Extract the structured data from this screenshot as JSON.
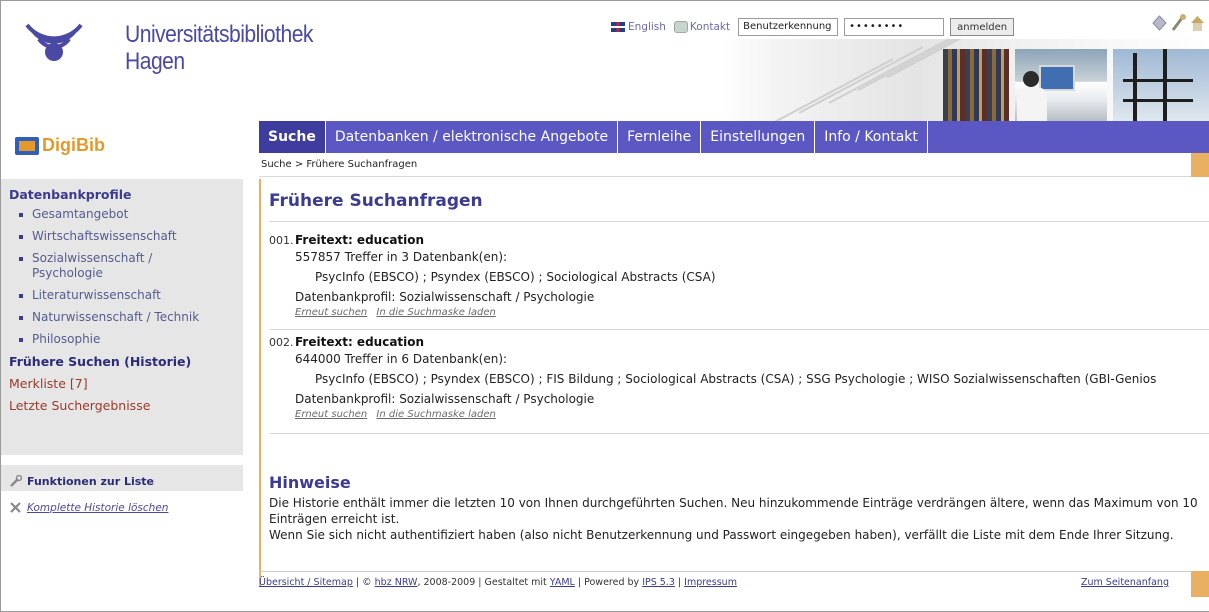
{
  "header": {
    "uni_name_line1": "Universitätsbibliothek",
    "uni_name_line2": "Hagen",
    "english_label": "English",
    "contact_label": "Kontakt",
    "username_value": "Benutzerkennung",
    "password_value": "••••••••",
    "login_label": "anmelden"
  },
  "brand": {
    "digibib": "DigiBib"
  },
  "nav": {
    "tabs": [
      {
        "label": "Suche",
        "active": true
      },
      {
        "label": "Datenbanken / elektronische Angebote",
        "active": false
      },
      {
        "label": "Fernleihe",
        "active": false
      },
      {
        "label": "Einstellungen",
        "active": false
      },
      {
        "label": "Info / Kontakt",
        "active": false
      }
    ],
    "breadcrumb": "Suche > Frühere Suchanfragen"
  },
  "sidebar": {
    "profiles_heading": "Datenbankprofile",
    "items": [
      {
        "label": "Gesamtangebot"
      },
      {
        "label": "Wirtschaftswissenschaft"
      },
      {
        "label": "Sozialwissenschaft / Psychologie"
      },
      {
        "label": "Literaturwissenschaft"
      },
      {
        "label": "Naturwissenschaft / Technik"
      },
      {
        "label": "Philosophie"
      }
    ],
    "history_label": "Frühere Suchen (Historie)",
    "watchlist_label": "Merkliste [7]",
    "last_results_label": "Letzte Suchergebnisse",
    "functions_title": "Funktionen zur Liste",
    "clear_history_label": "Komplette Historie löschen"
  },
  "main": {
    "title": "Frühere Suchanfragen",
    "entries": [
      {
        "number": "001.",
        "query": "Freitext: education",
        "hits": "557857 Treffer in 3 Datenbank(en):",
        "databases": "PsycInfo (EBSCO) ;  Psyndex (EBSCO) ;  Sociological Abstracts (CSA)",
        "profile": "Datenbankprofil: Sozialwissenschaft / Psychologie",
        "action_search_again": "Erneut suchen",
        "action_load_mask": "In die Suchmaske laden"
      },
      {
        "number": "002.",
        "query": "Freitext: education",
        "hits": "644000 Treffer in 6 Datenbank(en):",
        "databases": "PsycInfo (EBSCO) ;  Psyndex (EBSCO) ;  FIS Bildung ;  Sociological Abstracts (CSA) ;  SSG Psychologie ;  WISO Sozialwissenschaften (GBI-Genios",
        "profile": "Datenbankprofil: Sozialwissenschaft / Psychologie",
        "action_search_again": "Erneut suchen",
        "action_load_mask": "In die Suchmaske laden"
      }
    ],
    "hints_title": "Hinweise",
    "hints_line1": "Die Historie enthält immer die letzten 10 von Ihnen durchgeführten Suchen. Neu hinzukommende Einträge verdrängen ältere, wenn das Maximum von 10 Einträgen erreicht ist.",
    "hints_line2": "Wenn Sie sich nicht authentifiziert haben (also nicht Benutzerkennung und Passwort eingegeben haben), verfällt die Liste mit dem Ende Ihrer Sitzung."
  },
  "footer": {
    "sitemap": "Übersicht / Sitemap",
    "sep1": " | © ",
    "hbz": "hbz NRW",
    "years": ", 2008-2009 | Gestaltet mit ",
    "yaml": "YAML",
    "powered": " | Powered by ",
    "ips": "IPS 5.3",
    "sep2": " | ",
    "impressum": "Impressum",
    "to_top": "Zum Seitenanfang"
  },
  "colors": {
    "nav_bg": "#5b58c4",
    "accent_orange": "#e8b060",
    "heading_blue": "#3b3b90",
    "digibib_orange": "#e49a2a"
  }
}
